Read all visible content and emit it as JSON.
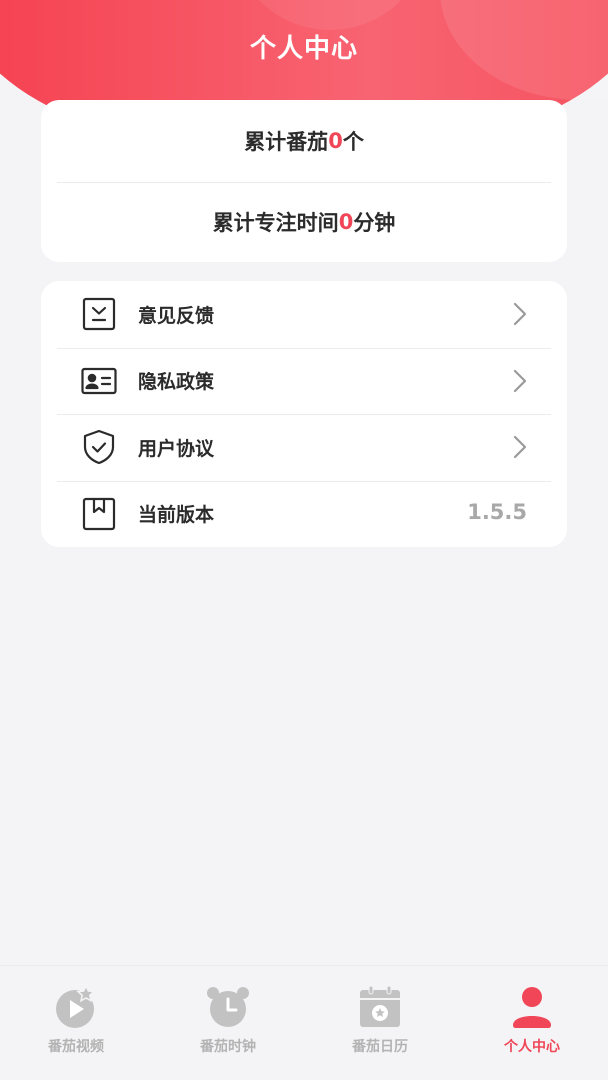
{
  "header": {
    "title": "个人中心"
  },
  "stats": [
    {
      "prefix": "累计番茄",
      "value": "0",
      "suffix": "个"
    },
    {
      "prefix": "累计专注时间",
      "value": "0",
      "suffix": "分钟"
    }
  ],
  "menu": [
    {
      "label": "意见反馈",
      "icon": "feedback-icon",
      "type": "link"
    },
    {
      "label": "隐私政策",
      "icon": "id-card-icon",
      "type": "link"
    },
    {
      "label": "用户协议",
      "icon": "shield-check-icon",
      "type": "link"
    },
    {
      "label": "当前版本",
      "icon": "bookmark-icon",
      "type": "value",
      "value": "1.5.5"
    }
  ],
  "tabs": [
    {
      "label": "番茄视频",
      "icon": "video-play-icon",
      "active": false
    },
    {
      "label": "番茄时钟",
      "icon": "alarm-clock-icon",
      "active": false
    },
    {
      "label": "番茄日历",
      "icon": "calendar-icon",
      "active": false
    },
    {
      "label": "个人中心",
      "icon": "user-icon",
      "active": true
    }
  ],
  "colors": {
    "accent": "#f04657",
    "header_gradient_start": "#f5404f",
    "header_gradient_end": "#f86472",
    "tab_inactive": "#b3b3b3",
    "background": "#f4f4f6"
  }
}
